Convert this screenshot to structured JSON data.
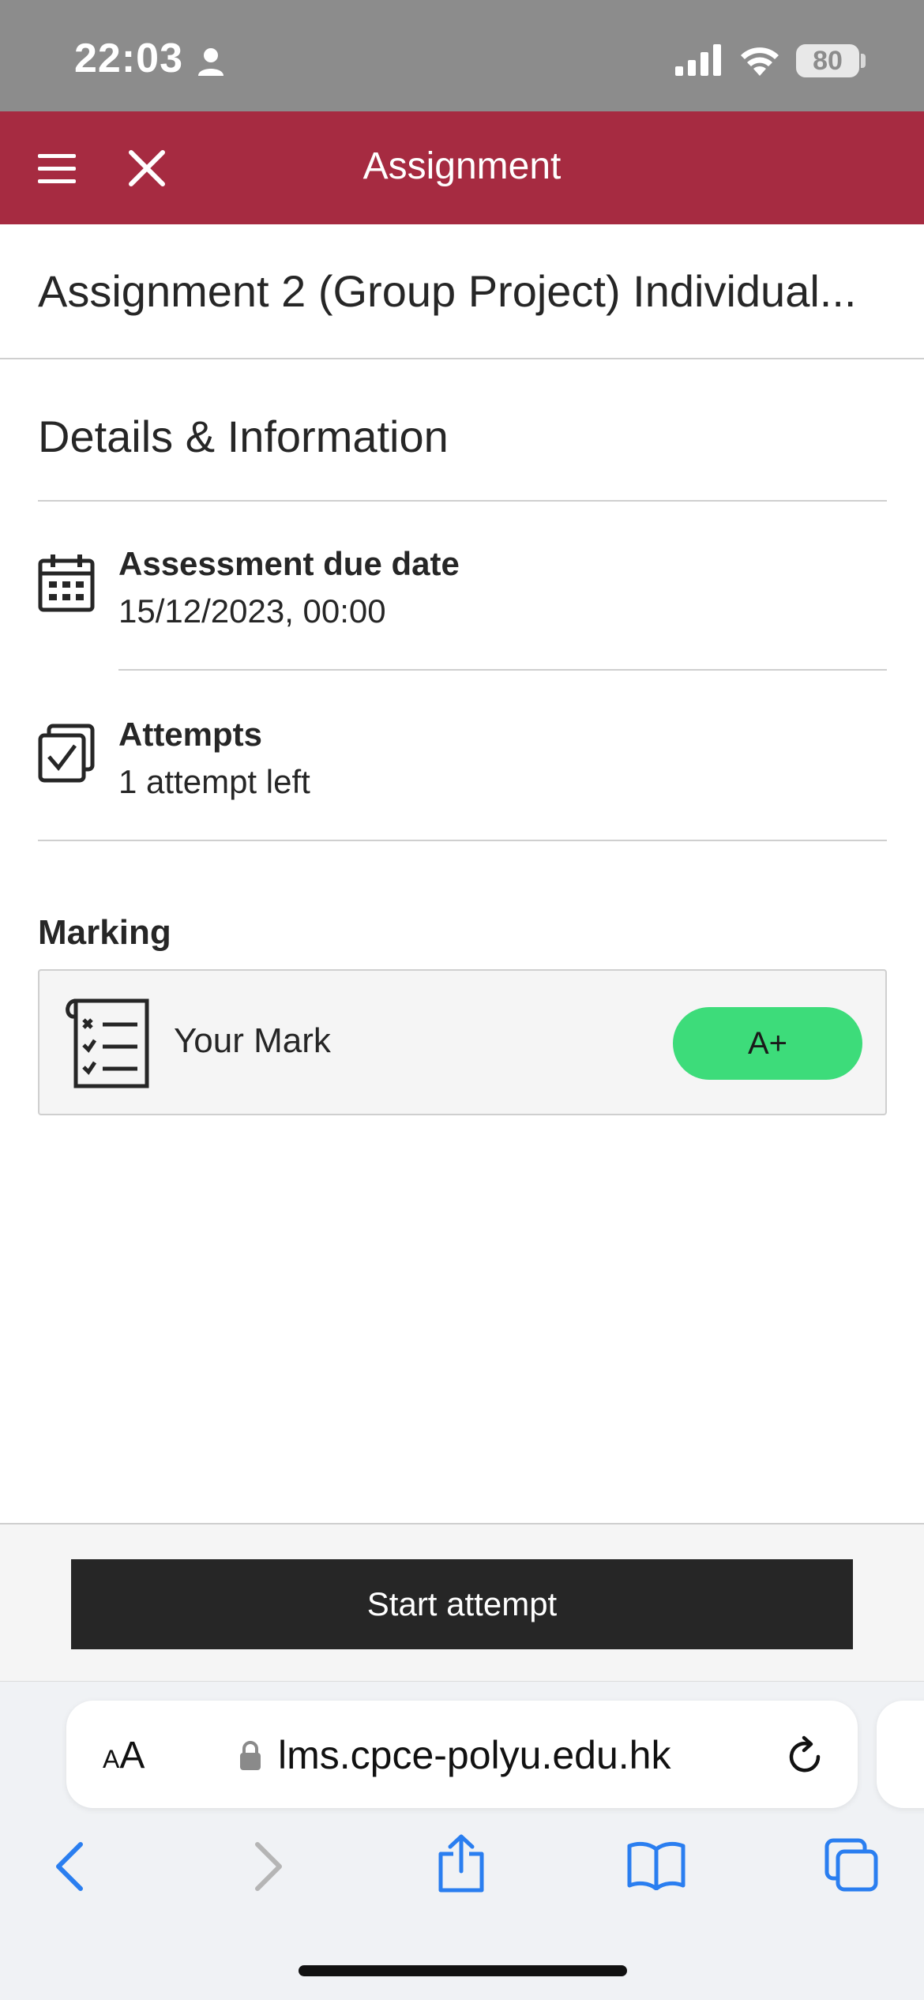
{
  "status_bar": {
    "time": "22:03",
    "battery": "80"
  },
  "header": {
    "title": "Assignment"
  },
  "assignment": {
    "title": "Assignment 2 (Group Project) Individual..."
  },
  "details": {
    "section_title": "Details & Information",
    "due_date": {
      "label": "Assessment due date",
      "value": "15/12/2023, 00:00"
    },
    "attempts": {
      "label": "Attempts",
      "value": "1 attempt left"
    }
  },
  "marking": {
    "label": "Marking",
    "your_mark_label": "Your Mark",
    "grade": "A+",
    "grade_color": "#3ddc7a"
  },
  "actions": {
    "start_attempt": "Start attempt"
  },
  "browser": {
    "aa_small": "A",
    "aa_large": "A",
    "url": "lms.cpce-polyu.edu.hk"
  },
  "colors": {
    "header_bg": "#a62b41",
    "button_bg": "#262626",
    "browser_accent": "#2a7ef0"
  }
}
